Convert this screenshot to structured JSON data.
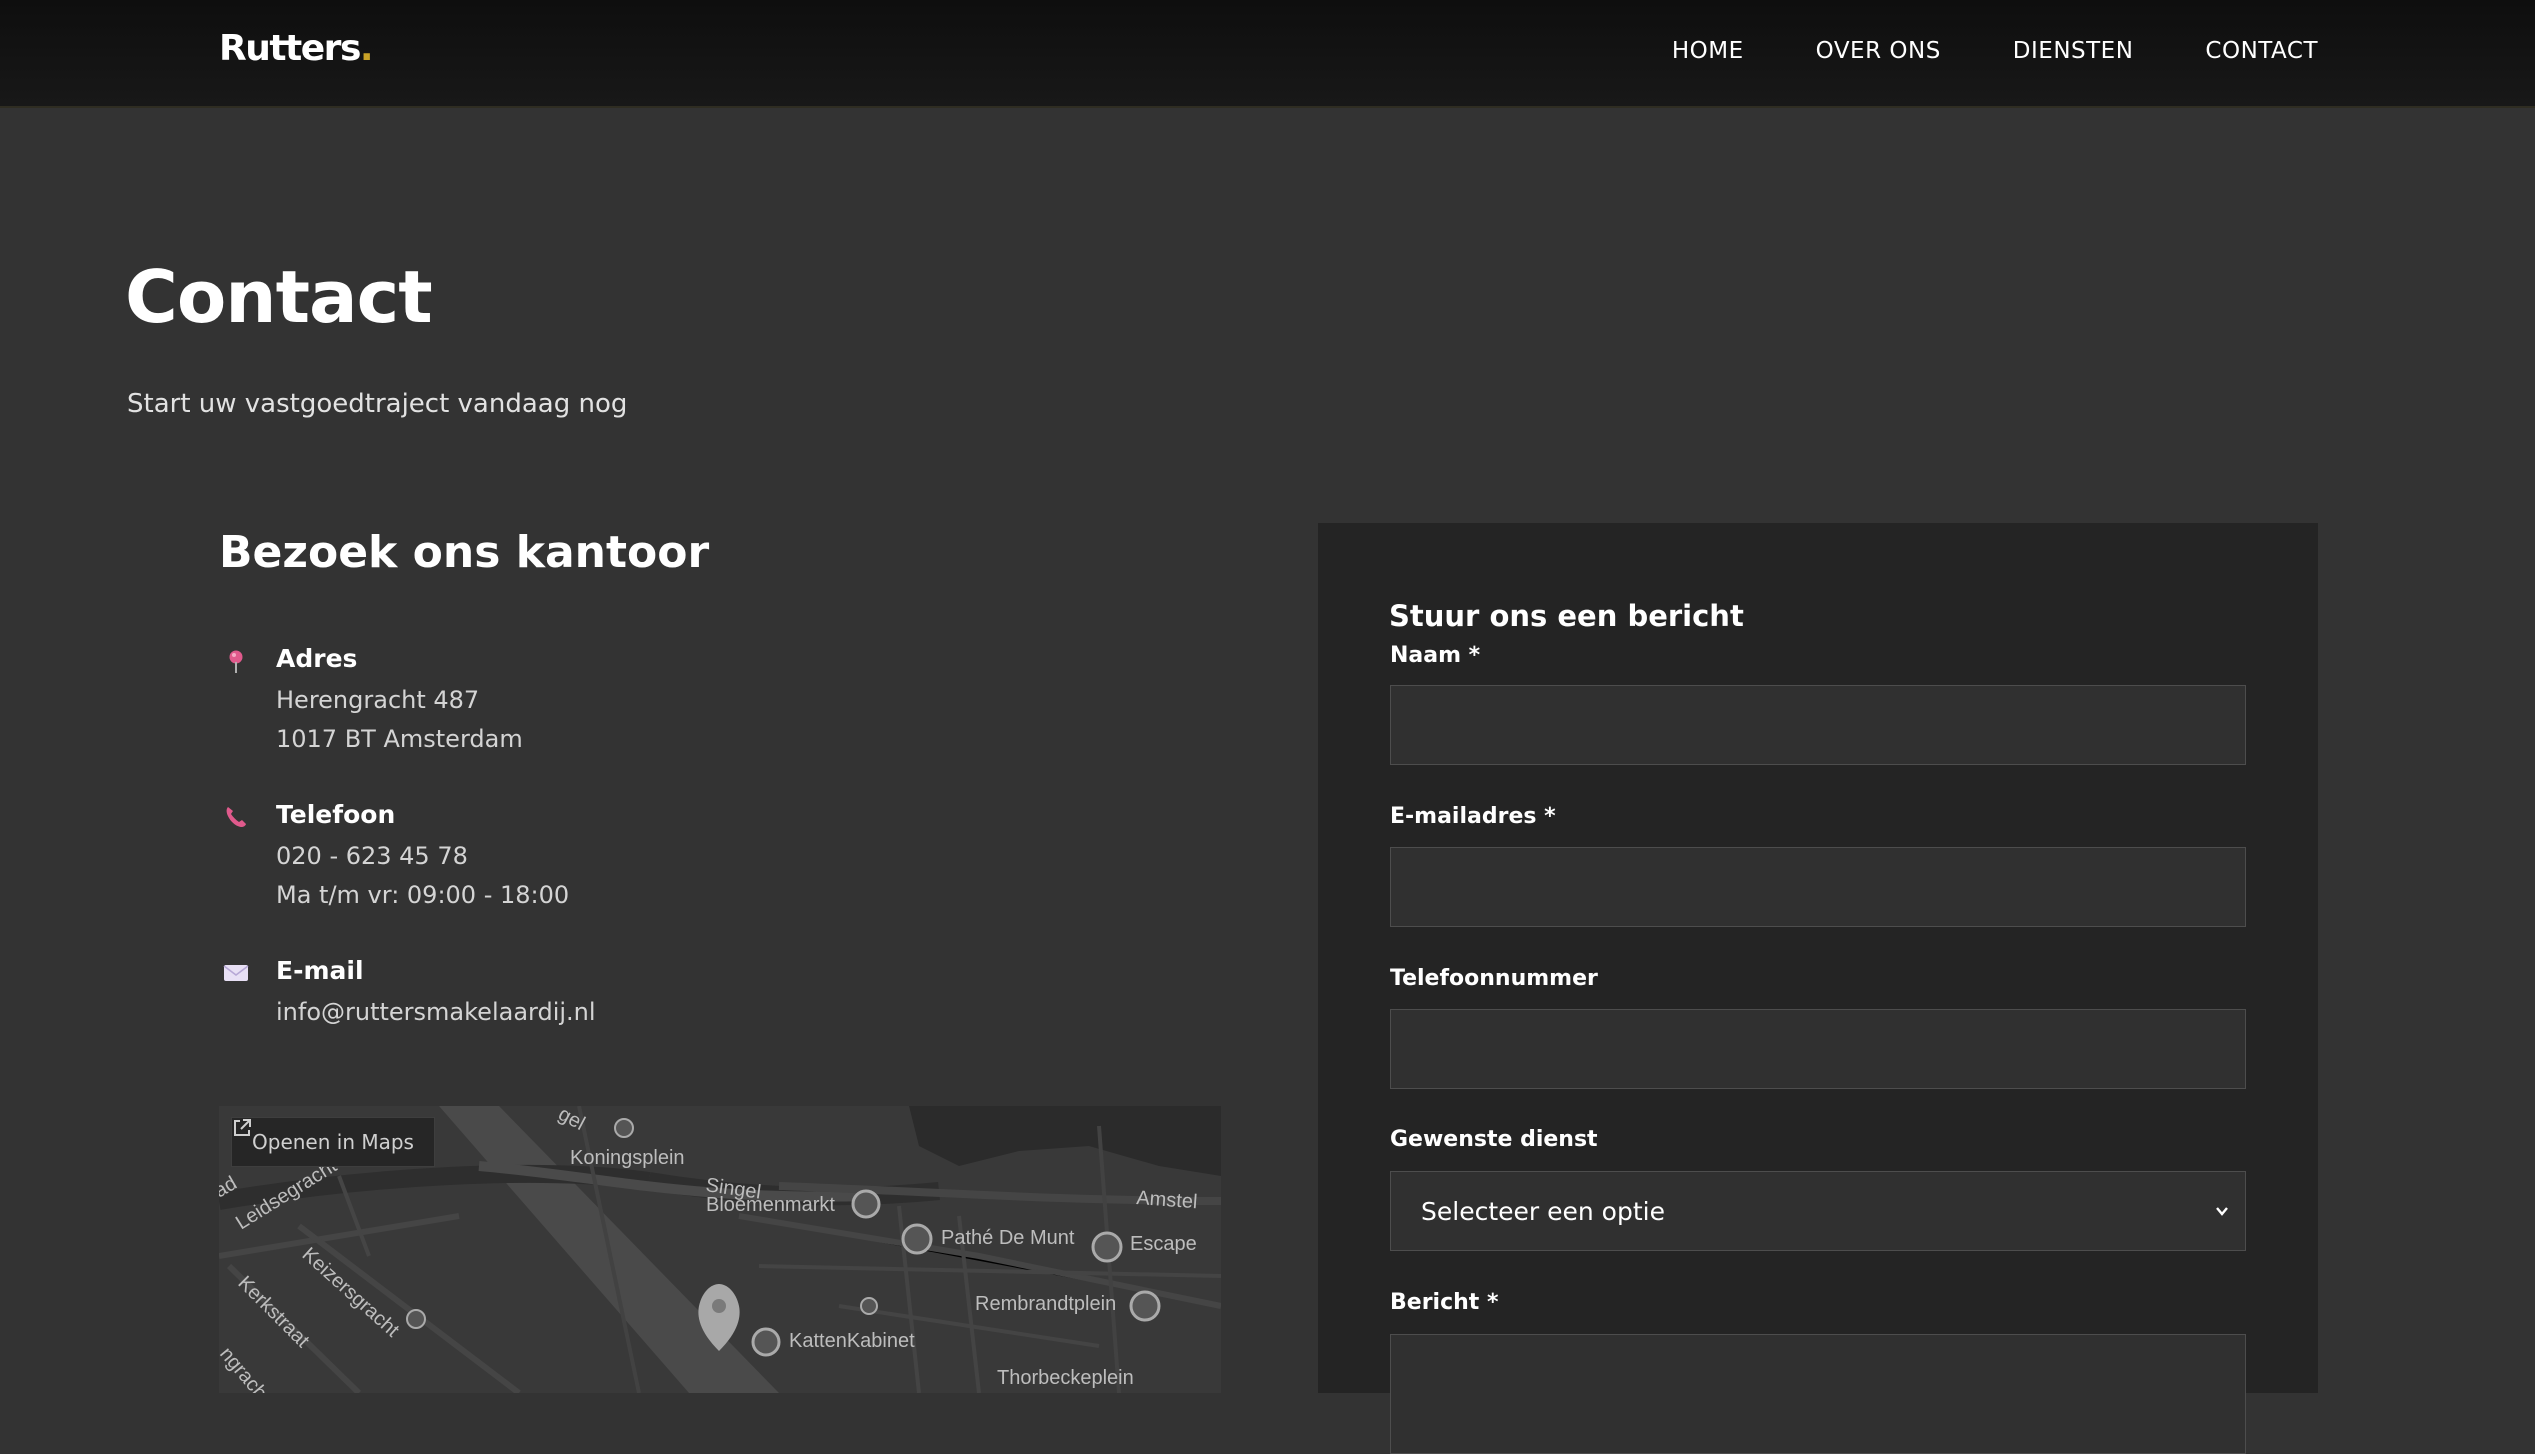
{
  "brand": {
    "name": "Rutters",
    "dot": "."
  },
  "nav": [
    {
      "label": "HOME"
    },
    {
      "label": "OVER ONS"
    },
    {
      "label": "DIENSTEN"
    },
    {
      "label": "CONTACT"
    }
  ],
  "hero": {
    "title": "Contact",
    "subtitle": "Start uw vastgoedtraject vandaag nog"
  },
  "visit": {
    "title": "Bezoek ons kantoor",
    "address": {
      "label": "Adres",
      "lines": [
        "Herengracht 487",
        "1017 BT Amsterdam"
      ],
      "icon": "pin-icon"
    },
    "phone": {
      "label": "Telefoon",
      "lines": [
        "020 - 623 45 78",
        "Ma t/m vr: 09:00 - 18:00"
      ],
      "icon": "phone-icon"
    },
    "email": {
      "label": "E-mail",
      "lines": [
        "info@ruttersmakelaardij.nl"
      ],
      "icon": "envelope-icon"
    }
  },
  "map": {
    "open_label": "Openen in Maps",
    "places": [
      "Koningsplein",
      "Singel",
      "Bloemenmarkt",
      "Amstel",
      "Pathé De Munt",
      "Escape",
      "Rembrandtplein",
      "KattenKabinet",
      "Thorbeckeplein",
      "Leidsegracht",
      "Keizersgracht",
      "Kerkstraat",
      "ngracht",
      "ad",
      "gel"
    ]
  },
  "form": {
    "title": "Stuur ons een bericht",
    "name_label": "Naam *",
    "email_label": "E-mailadres *",
    "phone_label": "Telefoonnummer",
    "service_label": "Gewenste dienst",
    "service_selected": "Selecteer een optie",
    "message_label": "Bericht *"
  },
  "colors": {
    "accent_gold": "#c9a227",
    "accent_pink": "#e05a8c",
    "background": "#333333",
    "card": "#242424"
  }
}
